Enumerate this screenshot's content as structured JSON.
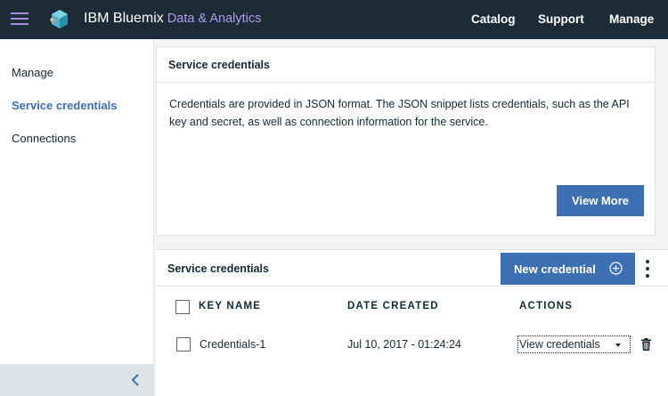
{
  "header": {
    "brand": "IBM Bluemix",
    "brand_sub": "Data & Analytics",
    "nav": [
      "Catalog",
      "Support",
      "Manage"
    ]
  },
  "sidebar": {
    "items": [
      {
        "label": "Manage",
        "active": false
      },
      {
        "label": "Service credentials",
        "active": true
      },
      {
        "label": "Connections",
        "active": false
      }
    ]
  },
  "info_panel": {
    "title": "Service credentials",
    "body": "Credentials are provided in JSON format. The JSON snippet lists credentials, such as the API key and secret, as well as connection information for the service.",
    "button": "View More"
  },
  "credentials_panel": {
    "title": "Service credentials",
    "new_button": "New credential",
    "columns": [
      "KEY NAME",
      "DATE CREATED",
      "ACTIONS"
    ],
    "rows": [
      {
        "key_name": "Credentials-1",
        "date_created": "Jul 10, 2017 - 01:24:24",
        "action": "View credentials"
      }
    ]
  },
  "colors": {
    "topbar": "#1d2b36",
    "accent": "#3d70b2",
    "brand_sub": "#b29bf0"
  }
}
